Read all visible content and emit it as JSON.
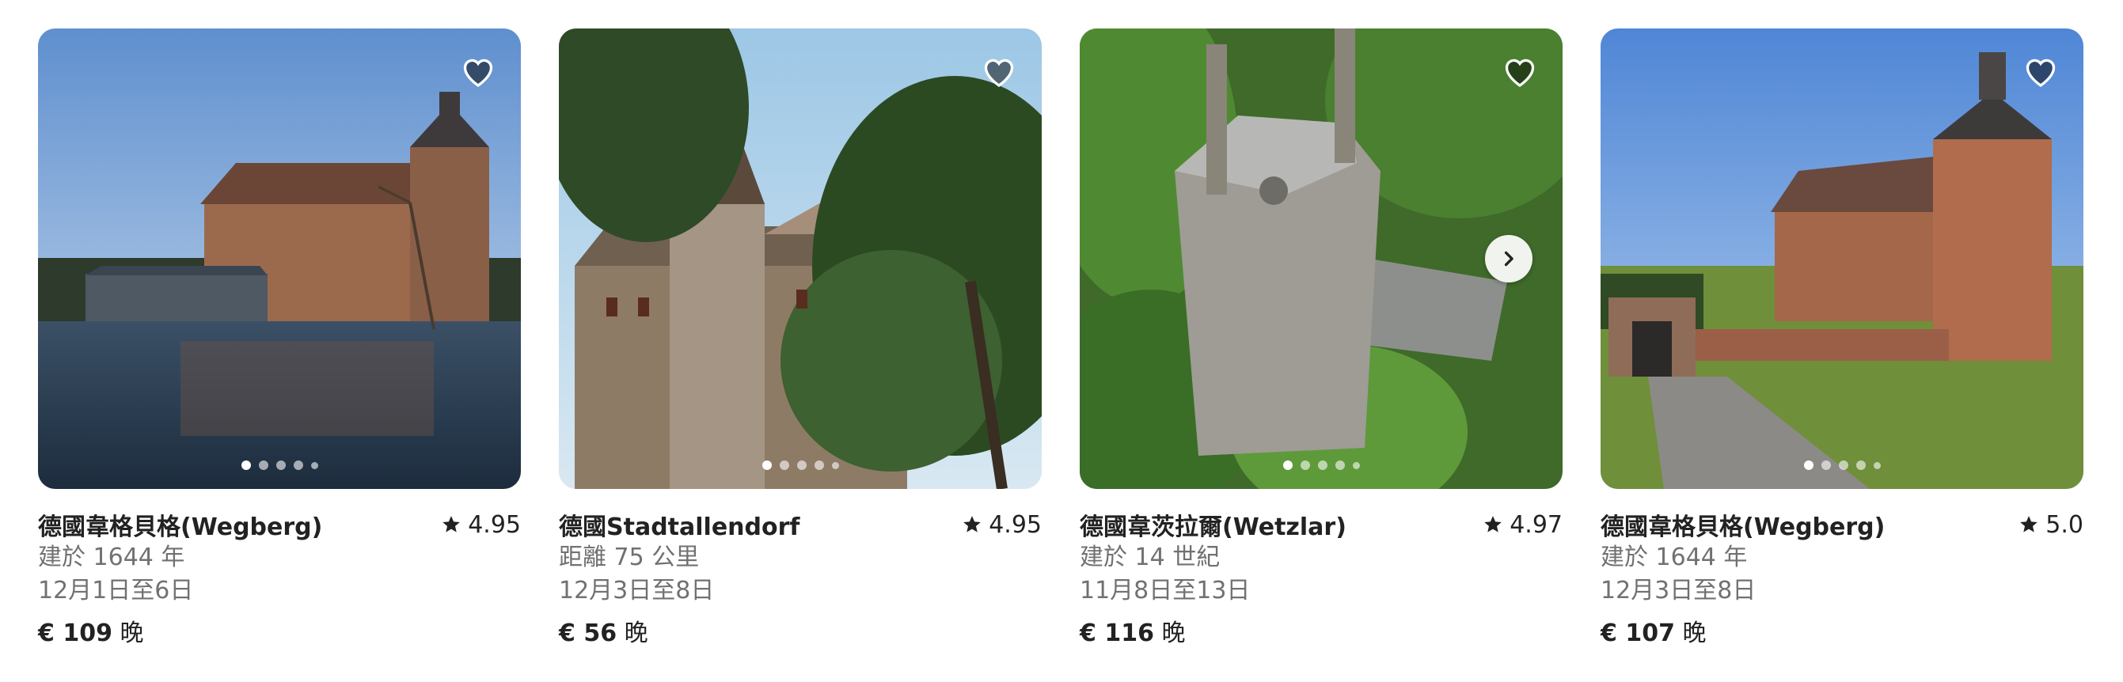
{
  "listings": [
    {
      "title": "德國韋格貝格(Wegberg)",
      "rating": "4.95",
      "detail": "建於 1644 年",
      "dates": "12月1日至6日",
      "price": "€ 109",
      "unit": "晚",
      "image_alt": "moated castle",
      "favorite_icon": "heart-icon"
    },
    {
      "title": "德國Stadtallendorf",
      "rating": "4.95",
      "detail": "距離 75 公里",
      "dates": "12月3日至8日",
      "price": "€ 56",
      "unit": "晚",
      "image_alt": "castle with spire",
      "favorite_icon": "heart-icon"
    },
    {
      "title": "德國韋茨拉爾(Wetzlar)",
      "rating": "4.97",
      "detail": "建於 14 世紀",
      "dates": "11月8日至13日",
      "price": "€ 116",
      "unit": "晚",
      "image_alt": "stone tower in forest",
      "favorite_icon": "heart-icon",
      "next_icon": "chevron-right-icon"
    },
    {
      "title": "德國韋格貝格(Wegberg)",
      "rating": "5.0",
      "detail": "建於 1644 年",
      "dates": "12月3日至8日",
      "price": "€ 107",
      "unit": "晚",
      "image_alt": "brick manor with tower",
      "favorite_icon": "heart-icon"
    }
  ],
  "colors": {
    "text": "#222222",
    "secondary_text": "#717171",
    "favorite_fill": "rgba(0,0,0,0.5)"
  }
}
